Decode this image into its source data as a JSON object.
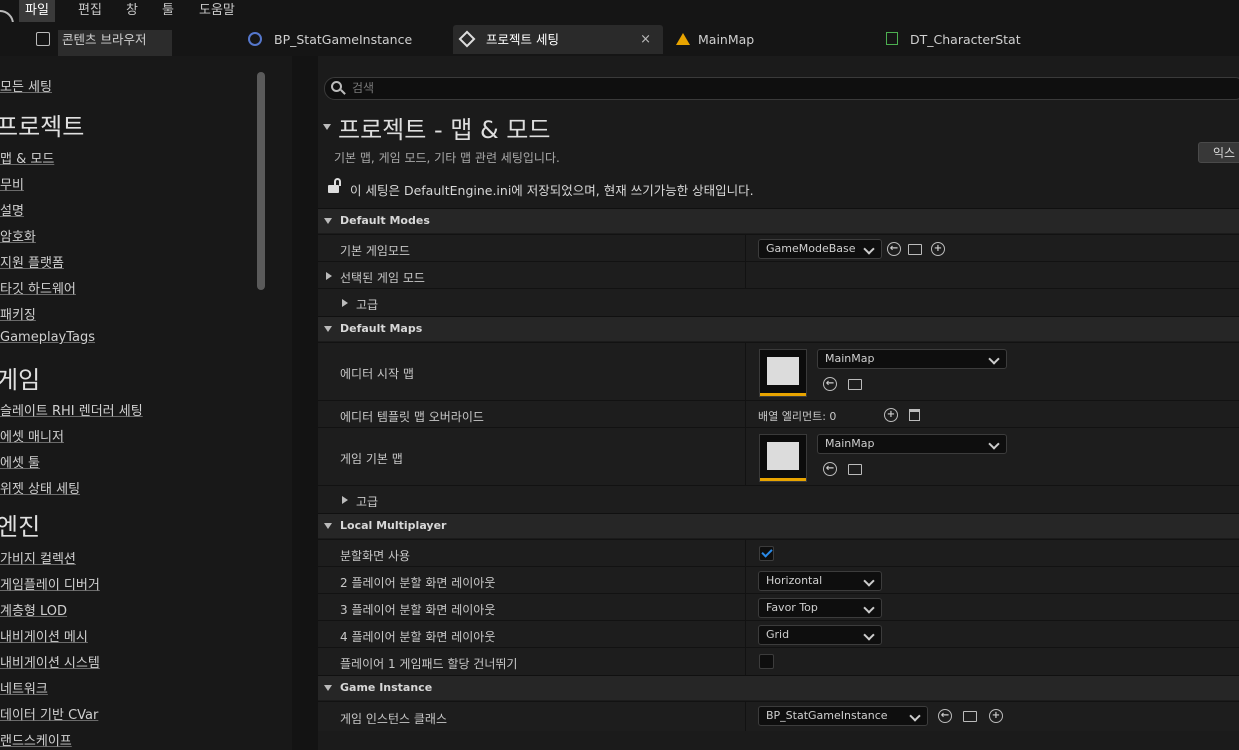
{
  "menu": [
    "파일",
    "편집",
    "창",
    "툴",
    "도움말"
  ],
  "tabs": {
    "content_browser": "콘텐츠 브라우저",
    "bp_stat": "BP_StatGameInstance",
    "project_settings": "프로젝트 세팅",
    "close": "×",
    "mainmap": "MainMap",
    "dt_character": "DT_CharacterStat"
  },
  "sidebar": {
    "all_settings": "모든 세팅",
    "groups": [
      {
        "title": "프로젝트",
        "items": [
          "맵 & 모드",
          "무비",
          "설명",
          "암호화",
          "지원 플랫폼",
          "타깃 하드웨어",
          "패키징",
          "GameplayTags"
        ]
      },
      {
        "title": "게임",
        "items": [
          "슬레이트 RHI 렌더러 세팅",
          "에셋 매니저",
          "에셋 툴",
          "위젯 상태 세팅"
        ]
      },
      {
        "title": "엔진",
        "items": [
          "가비지 컬렉션",
          "게임플레이 디버거",
          "계층형 LOD",
          "내비게이션 메시",
          "내비게이션 시스템",
          "네트워크",
          "데이터 기반 CVar",
          "랜드스케이프"
        ]
      }
    ]
  },
  "search": {
    "placeholder": "검색"
  },
  "page": {
    "title": "프로젝트 - 맵 & 모드",
    "description": "기본 맵, 게임 모드, 기타 맵 관련 세팅입니다.",
    "export_label": "익스",
    "notice": "이 세팅은 DefaultEngine.ini에 저장되었으며, 현재 쓰기가능한 상태입니다."
  },
  "sections": {
    "default_modes": {
      "title": "Default Modes",
      "default_gamemode_label": "기본 게임모드",
      "default_gamemode_value": "GameModeBase",
      "selected_gamemode_label": "선택된 게임 모드",
      "advanced_label": "고급"
    },
    "default_maps": {
      "title": "Default Maps",
      "editor_startup_label": "에디터 시작 맵",
      "editor_startup_value": "MainMap",
      "editor_template_label": "에디터 템플릿 맵 오버라이드",
      "array_elements": "배열 엘리먼트: 0",
      "game_default_label": "게임 기본 맵",
      "game_default_value": "MainMap",
      "advanced_label": "고급"
    },
    "local_multiplayer": {
      "title": "Local Multiplayer",
      "splitscreen_label": "분할화면 사용",
      "splitscreen_checked": true,
      "two_player_label": "2 플레이어 분할 화면 레이아웃",
      "two_player_value": "Horizontal",
      "three_player_label": "3 플레이어 분할 화면 레이아웃",
      "three_player_value": "Favor Top",
      "four_player_label": "4 플레이어 분할 화면 레이아웃",
      "four_player_value": "Grid",
      "skip_gamepad_label": "플레이어 1 게임패드 할당 건너뛰기",
      "skip_gamepad_checked": false
    },
    "game_instance": {
      "title": "Game Instance",
      "class_label": "게임 인스턴스 클래스",
      "class_value": "BP_StatGameInstance"
    }
  },
  "icons": {
    "plus": "+",
    "back": "←"
  }
}
